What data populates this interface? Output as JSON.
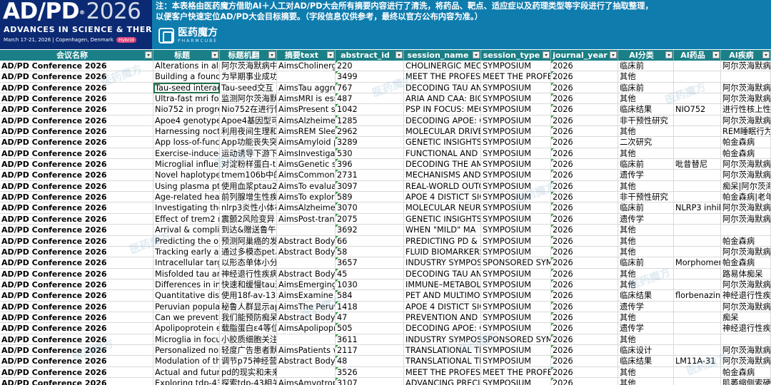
{
  "banner": {
    "brand_title_main": "AD/PD",
    "brand_title_year": "2026",
    "brand_subtitle": "ADVANCES IN SCIENCE & THERAPY",
    "brand_date": "March 17-21, 2026 | Copenhagen, Denmark",
    "brand_badge": "Hybrid",
    "notice_line1": "注：本表格由医药魔方借助AI＋人工对AD/PD大会所有摘要内容进行了清洗，将药品、靶点、适应症以及药理类型等字段进行了抽取整理，",
    "notice_line2": "以便客户快速定位AD/PD大会目标摘要。（字段信息仅供参考，最终以官方公布内容为准。）",
    "logo_name": "医药魔方",
    "logo_en": "PHARMCUBE",
    "watermark": "医药魔方"
  },
  "columns": [
    "会议名称",
    "标题",
    "标题机翻",
    "摘要text",
    "abstract_id",
    "session_name",
    "session_type",
    "journal_year",
    "AI分类",
    "AI药品",
    "AI疾病"
  ],
  "rows": [
    [
      "AD/PD Conference 2026",
      "Alterations in alpha",
      "阿尔茨海默病中",
      "AimsCholinergic",
      "220",
      "CHOLINERGIC MECH",
      "SYMPOSIUM",
      "2026",
      "临床前",
      "",
      "阿尔茨海默病"
    ],
    [
      "AD/PD Conference 2026",
      "Building a foundation",
      "为早期事业成功打下基础",
      "",
      "3499",
      "MEET THE PROFESS",
      "MEET THE PROFESS",
      "2026",
      "其他",
      "",
      ""
    ],
    [
      "AD/PD Conference 2026",
      "Tau-seed interact",
      "Tau-seed交互",
      "AimsTau aggre",
      "767",
      "DECODING TAU AN",
      "SYMPOSIUM",
      "2026",
      "临床前",
      "",
      "阿尔茨海默病"
    ],
    [
      "AD/PD Conference 2026",
      "Ultra-fast mri for",
      "监测阿尔茨海默",
      "AimsMRI is essen",
      "487",
      "ARIA AND CAA: BIO",
      "SYMPOSIUM",
      "2026",
      "其他",
      "",
      "阿尔茨海默病"
    ],
    [
      "AD/PD Conference 2026",
      "Nio752 in progress",
      "Nio752在进行性",
      "AimsPresent sa",
      "1042",
      "PSP IN FOCUS: MEC",
      "SYMPOSIUM",
      "2026",
      "临床结果",
      "NIO752",
      "进行性核上性"
    ],
    [
      "AD/PD Conference 2026",
      "Apoe4 genotype",
      "Apoe4基因型可",
      "AimsAlzheimer",
      "1285",
      "DECODING APOE: G",
      "SYMPOSIUM",
      "2026",
      "非干预性研究",
      "",
      "阿尔茨海默病"
    ],
    [
      "AD/PD Conference 2026",
      "Harnessing noctu",
      "利用夜间生理和",
      "AimsREM Sleep",
      "2962",
      "MOLECULAR DRIVE",
      "SYMPOSIUM",
      "2026",
      "其他",
      "",
      "REM睡眠行为"
    ],
    [
      "AD/PD Conference 2026",
      "App loss-of-funct",
      "App功能丧失突",
      "AimsAmyloid p",
      "3289",
      "GENETIC INSIGHTS",
      "SYMPOSIUM",
      "2026",
      "二次研究",
      "",
      "帕金森病"
    ],
    [
      "AD/PD Conference 2026",
      "Exercise-induced",
      "运动诱导下游下",
      "AimsInvestigate",
      "530",
      "FUNCTIONAL AND S",
      "SYMPOSIUM",
      "2026",
      "其他",
      "",
      "帕金森病"
    ],
    [
      "AD/PD Conference 2026",
      "Microglial influen",
      "对淀粉样蛋白-t",
      "AimsGenetic stu",
      "396",
      "DECODING THE AM",
      "SYMPOSIUM",
      "2026",
      "临床前",
      "吡昔替尼",
      "阿尔茨海默病"
    ],
    [
      "AD/PD Conference 2026",
      "Novel haplotypes",
      "tmem106b中的",
      "AimsCommon",
      "2731",
      "MECHANISMS AND",
      "SYMPOSIUM",
      "2026",
      "遗传学",
      "",
      "阿尔茨海默病"
    ],
    [
      "AD/PD Conference 2026",
      "Using plasma ptau",
      "使用血浆ptau2",
      "AimsTo evaluat",
      "3097",
      "REAL-WORLD OUTC",
      "SYMPOSIUM",
      "2026",
      "其他",
      "",
      "痴呆|阿尔茨海"
    ],
    [
      "AD/PD Conference 2026",
      "Age-related hearing",
      "前列腺增生性疾",
      "AimsTo explore",
      "589",
      "APOE 4 DISTICT SIG",
      "SYMPOSIUM",
      "2026",
      "非干预性研究",
      "",
      "帕金森病|老年"
    ],
    [
      "AD/PD Conference 2026",
      "Investigating the",
      "nlrp3炎性小体在",
      "AimsAlzheimer",
      "3070",
      "MOLECULAR NEUR",
      "SYMPOSIUM",
      "2026",
      "临床前",
      "NLRP3 inhib",
      "阿尔茨海默病"
    ],
    [
      "AD/PD Conference 2026",
      "Effect of trem2 ris",
      "震颤2风险变异",
      "AimsPost-transl",
      "2075",
      "GENETIC INSIGHTS",
      "SYMPOSIUM",
      "2026",
      "遗传学",
      "",
      "阿尔茨海默病"
    ],
    [
      "AD/PD Conference 2026",
      "Arrival & compliment",
      "到达&赠送鲁午餐",
      "",
      "3692",
      "WHEN  \"MILD\"  MA",
      "SYMPOSIUM",
      "2026",
      "其他",
      "",
      ""
    ],
    [
      "AD/PD Conference 2026",
      "Predicting the on",
      "预测阿巢癌的发",
      "Abstract BodyO",
      "66",
      "PREDICTING PD & L",
      "SYMPOSIUM",
      "2026",
      "其他",
      "",
      "帕金森病"
    ],
    [
      "AD/PD Conference 2026",
      "Tracking early ad",
      "通过多模态pet、",
      "Abstract BodyO",
      "58",
      "FLUID BIOMARKERS",
      "SYMPOSIUM",
      "2026",
      "其他",
      "",
      "阿尔茨海默病"
    ],
    [
      "AD/PD Conference 2026",
      "Intracellular targe",
      "以形态单体小分子靶向细胞内α-突",
      "",
      "3657",
      "INDUSTRY SYMPOS",
      "SPONSORED SYMP",
      "2026",
      "临床前",
      "Morphomer",
      "帕金森病"
    ],
    [
      "AD/PD Conference 2026",
      "Misfolded tau and",
      "神经退行性疾病",
      "Abstract BodyV",
      "45",
      "DECODING TAU AN",
      "SYMPOSIUM",
      "2026",
      "其他",
      "",
      "路易体痴呆"
    ],
    [
      "AD/PD Conference 2026",
      "Differences in infl",
      "快速和缓慢tau进",
      "AimsEmerging",
      "1030",
      "IMMUNE–METABOL",
      "SYMPOSIUM",
      "2026",
      "其他",
      "",
      "阿尔茨海默病"
    ],
    [
      "AD/PD Conference 2026",
      "Quantitative disc",
      "使用18f-av-133",
      "AimsExamine q",
      "584",
      "PET AND MULTIMO",
      "SYMPOSIUM",
      "2026",
      "临床结果",
      "florbenazine",
      "神经退行性疾"
    ],
    [
      "AD/PD Conference 2026",
      "Peruvian populati",
      "秘鲁人群显示ap",
      "AimsThe Peruvi",
      "1418",
      "APOE 4 DISTICT SIG",
      "SYMPOSIUM",
      "2026",
      "遗传学",
      "",
      "阿尔茨海默病"
    ],
    [
      "AD/PD Conference 2026",
      "Can we prevent d",
      "我们能预防痴呆",
      "Abstract BodyD",
      "47",
      "PREVENTION AND F",
      "SYMPOSIUM",
      "2026",
      "其他",
      "",
      "痴呆"
    ],
    [
      "AD/PD Conference 2026",
      "Apolipoprotein e",
      "载脂蛋白ε4等位",
      "AimsApolipopr",
      "505",
      "DECODING APOE: G",
      "SYMPOSIUM",
      "2026",
      "遗传学",
      "",
      "神经退行性疾"
    ],
    [
      "AD/PD Conference 2026",
      "Microglia in focus",
      "小胶质细胞关注:平衡保护和神经损",
      "",
      "3611",
      "INDUSTRY SYMPOS",
      "SPONSORED SYMP",
      "2026",
      "其他",
      "",
      ""
    ],
    [
      "AD/PD Conference 2026",
      "Personalized non",
      "轻度广告患者默",
      "AimsPatients wi",
      "2117",
      "TRANSLATIONAL TF",
      "SYMPOSIUM",
      "2026",
      "临床设计",
      "",
      "阿尔茨海默病"
    ],
    [
      "AD/PD Conference 2026",
      "Modulation of the",
      "调节p75神经营",
      "Abstract BodyC",
      "48",
      "TRANSLATIONAL TF",
      "SYMPOSIUM",
      "2026",
      "临床结果",
      "LM11A-31",
      "阿尔茨海默病"
    ],
    [
      "AD/PD Conference 2026",
      "Actual and future",
      "pd的现实和未来治疗",
      "",
      "3526",
      "MEET THE PROFESS",
      "MEET THE PROFESS",
      "2026",
      "其他",
      "",
      "帕金森病"
    ],
    [
      "AD/PD Conference 2026",
      "Exploring tdp-43-",
      "探索tdp-43相关",
      "AimsAmyotrop",
      "3107",
      "ADVANCING PRECIS",
      "SYMPOSIUM",
      "2026",
      "其他",
      "",
      "肌萎缩侧索硬"
    ]
  ]
}
